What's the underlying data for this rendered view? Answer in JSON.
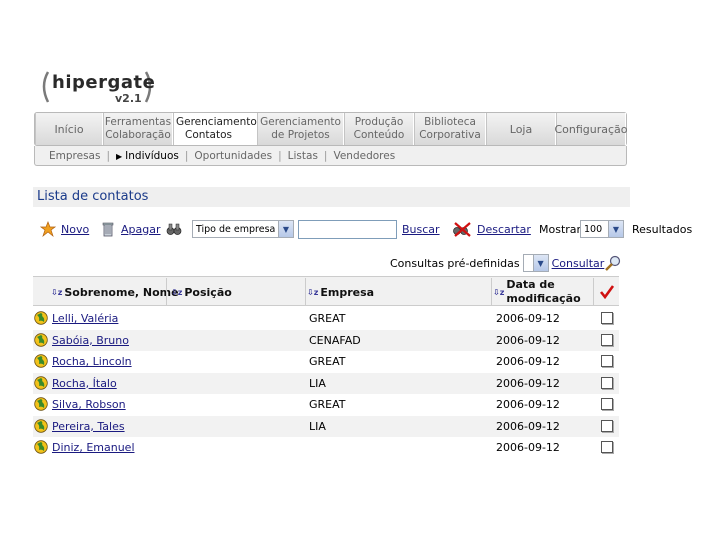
{
  "logo": {
    "name": "hipergate",
    "version": "v2.1"
  },
  "nav": {
    "tabs": [
      {
        "l1": "Início",
        "l2": ""
      },
      {
        "l1": "Ferramentas",
        "l2": "Colaboração"
      },
      {
        "l1": "Gerenciamento",
        "l2": "Contatos"
      },
      {
        "l1": "Gerenciamento",
        "l2": "de Projetos"
      },
      {
        "l1": "Produção",
        "l2": "Conteúdo"
      },
      {
        "l1": "Biblioteca",
        "l2": "Corporativa"
      },
      {
        "l1": "Loja",
        "l2": ""
      },
      {
        "l1": "Configuração",
        "l2": ""
      }
    ],
    "active_tab": 2
  },
  "subnav": {
    "items": [
      "Empresas",
      "Indivíduos",
      "Oportunidades",
      "Listas",
      "Vendedores"
    ],
    "active": 1
  },
  "title": "Lista de contatos",
  "toolbar": {
    "new_label": "Novo",
    "delete_label": "Apagar",
    "type_select": "Tipo de empresa",
    "search_value": "",
    "search_label": "Buscar",
    "discard_label": "Descartar",
    "show_label": "Mostrar",
    "show_count": "100",
    "results_label": "Resultados"
  },
  "predefined": {
    "label": "Consultas pré-definidas",
    "value": "",
    "consult_label": "Consultar"
  },
  "table": {
    "columns": [
      "Sobrenome, Nome",
      "Posição",
      "Empresa",
      "Data de",
      "modificação"
    ],
    "rows": [
      {
        "name": "Lelli, Valéria",
        "position": "",
        "company": "GREAT",
        "date": "2006-09-12"
      },
      {
        "name": "Sabóia, Bruno",
        "position": "",
        "company": "CENAFAD",
        "date": "2006-09-12"
      },
      {
        "name": "Rocha, Lincoln",
        "position": "",
        "company": "GREAT",
        "date": "2006-09-12"
      },
      {
        "name": "Rocha, Ítalo",
        "position": "",
        "company": "LIA",
        "date": "2006-09-12"
      },
      {
        "name": "Silva, Robson",
        "position": "",
        "company": "GREAT",
        "date": "2006-09-12"
      },
      {
        "name": "Pereira, Tales",
        "position": "",
        "company": "LIA",
        "date": "2006-09-12"
      },
      {
        "name": "Diniz, Emanuel",
        "position": "",
        "company": "",
        "date": "2006-09-12"
      }
    ]
  },
  "colors": {
    "link": "#1a1a80",
    "title": "#1a3a8a",
    "check": "#d01010"
  }
}
